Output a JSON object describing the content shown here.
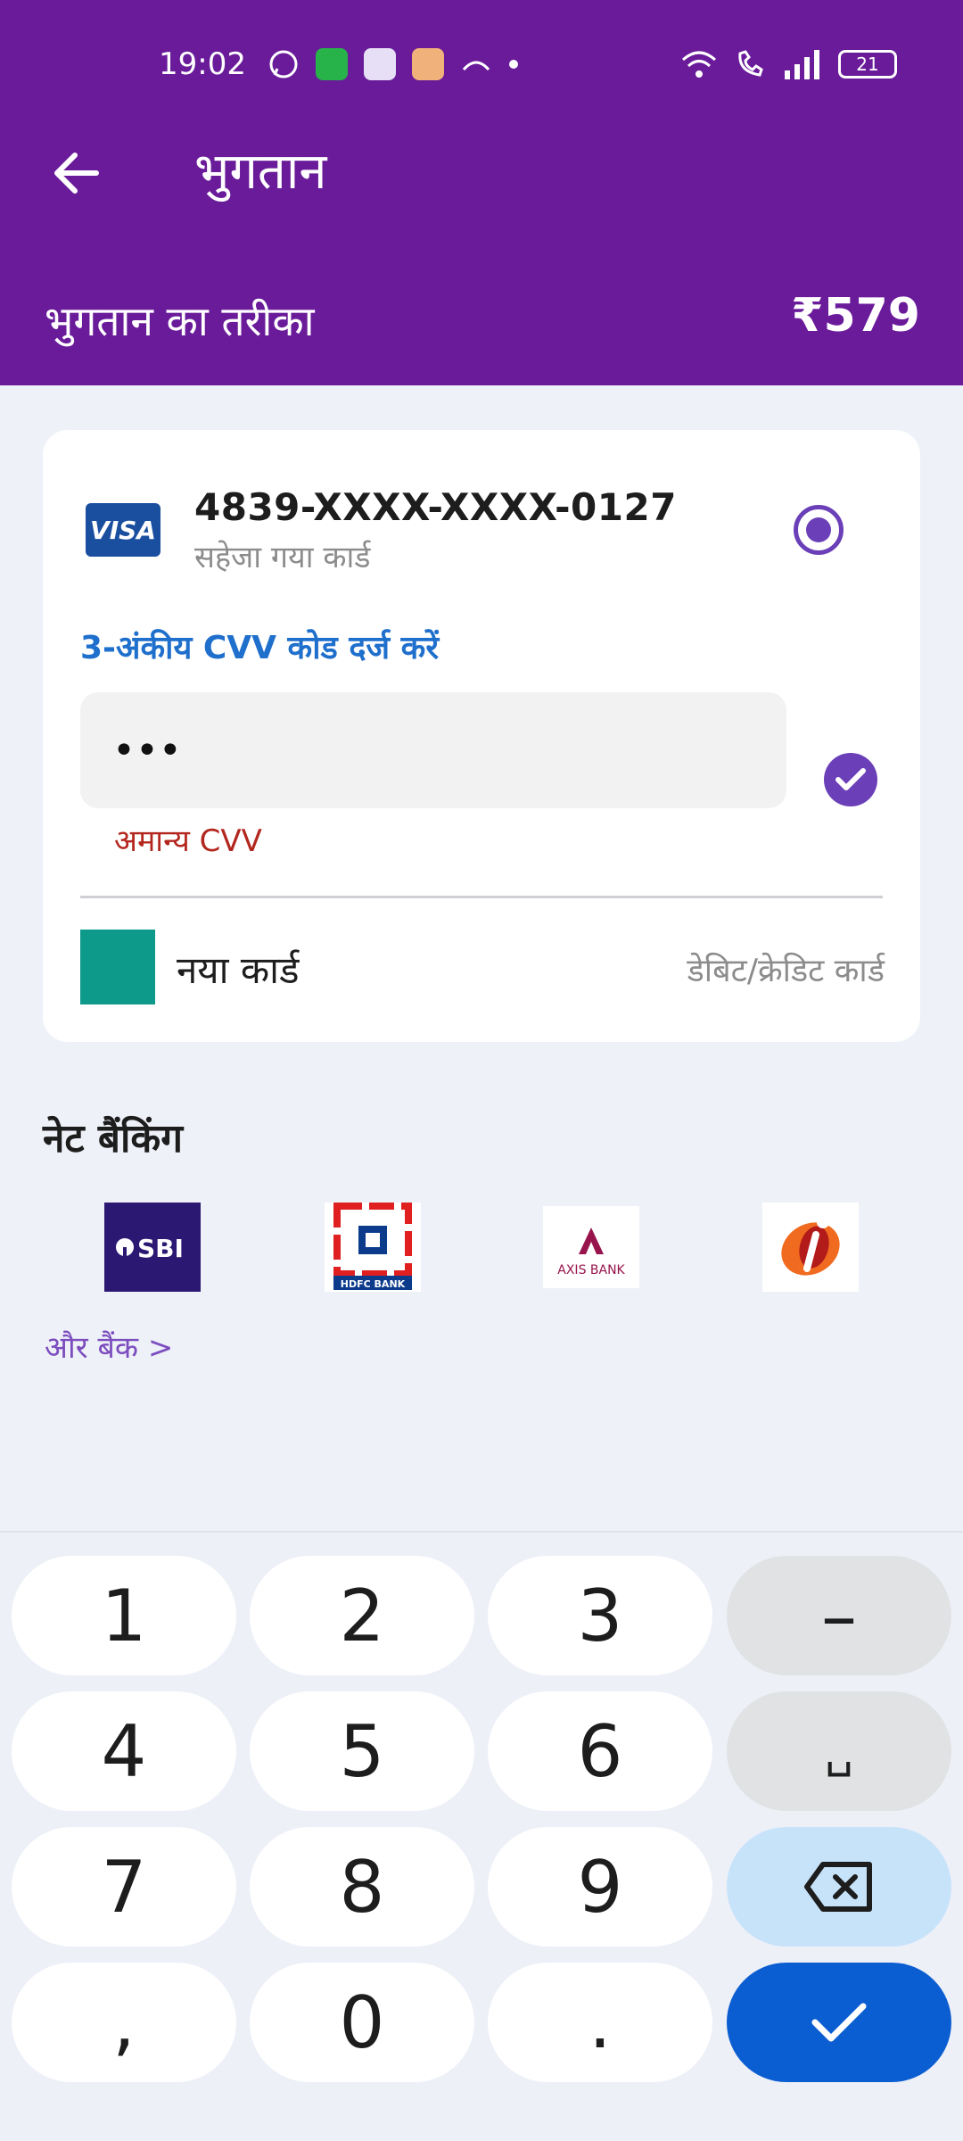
{
  "status_bar": {
    "time": "19:02",
    "battery": "21"
  },
  "header": {
    "title": "भुगतान",
    "method_label": "भुगतान का तरीका",
    "amount": "₹579"
  },
  "saved_card": {
    "brand": "VISA",
    "number": "4839-XXXX-XXXX-0127",
    "subtitle": "सहेजा गया कार्ड",
    "cvv_label": "3-अंकीय CVV कोड दर्ज करें",
    "cvv_value": "•••",
    "cvv_error": "अमान्य CVV"
  },
  "new_card": {
    "label": "नया कार्ड",
    "type": "डेबिट/क्रेडिट कार्ड"
  },
  "net_banking": {
    "title": "नेट बैंकिंग",
    "banks": [
      {
        "name": "SBI"
      },
      {
        "name": "HDFC BANK"
      },
      {
        "name": "AXIS BANK"
      },
      {
        "name": "ICICI"
      }
    ],
    "more_label": "और बैंक >"
  },
  "keypad": {
    "keys": [
      "1",
      "2",
      "3",
      "–",
      "4",
      "5",
      "6",
      "␣",
      "7",
      "8",
      "9",
      "⌫",
      ",",
      "0",
      ".",
      "✓"
    ]
  },
  "colors": {
    "header_bg": "#6a1b9a",
    "accent": "#6a3fb8",
    "link": "#1f6fcc",
    "error": "#b3261e",
    "confirm": "#0b5ed1"
  }
}
